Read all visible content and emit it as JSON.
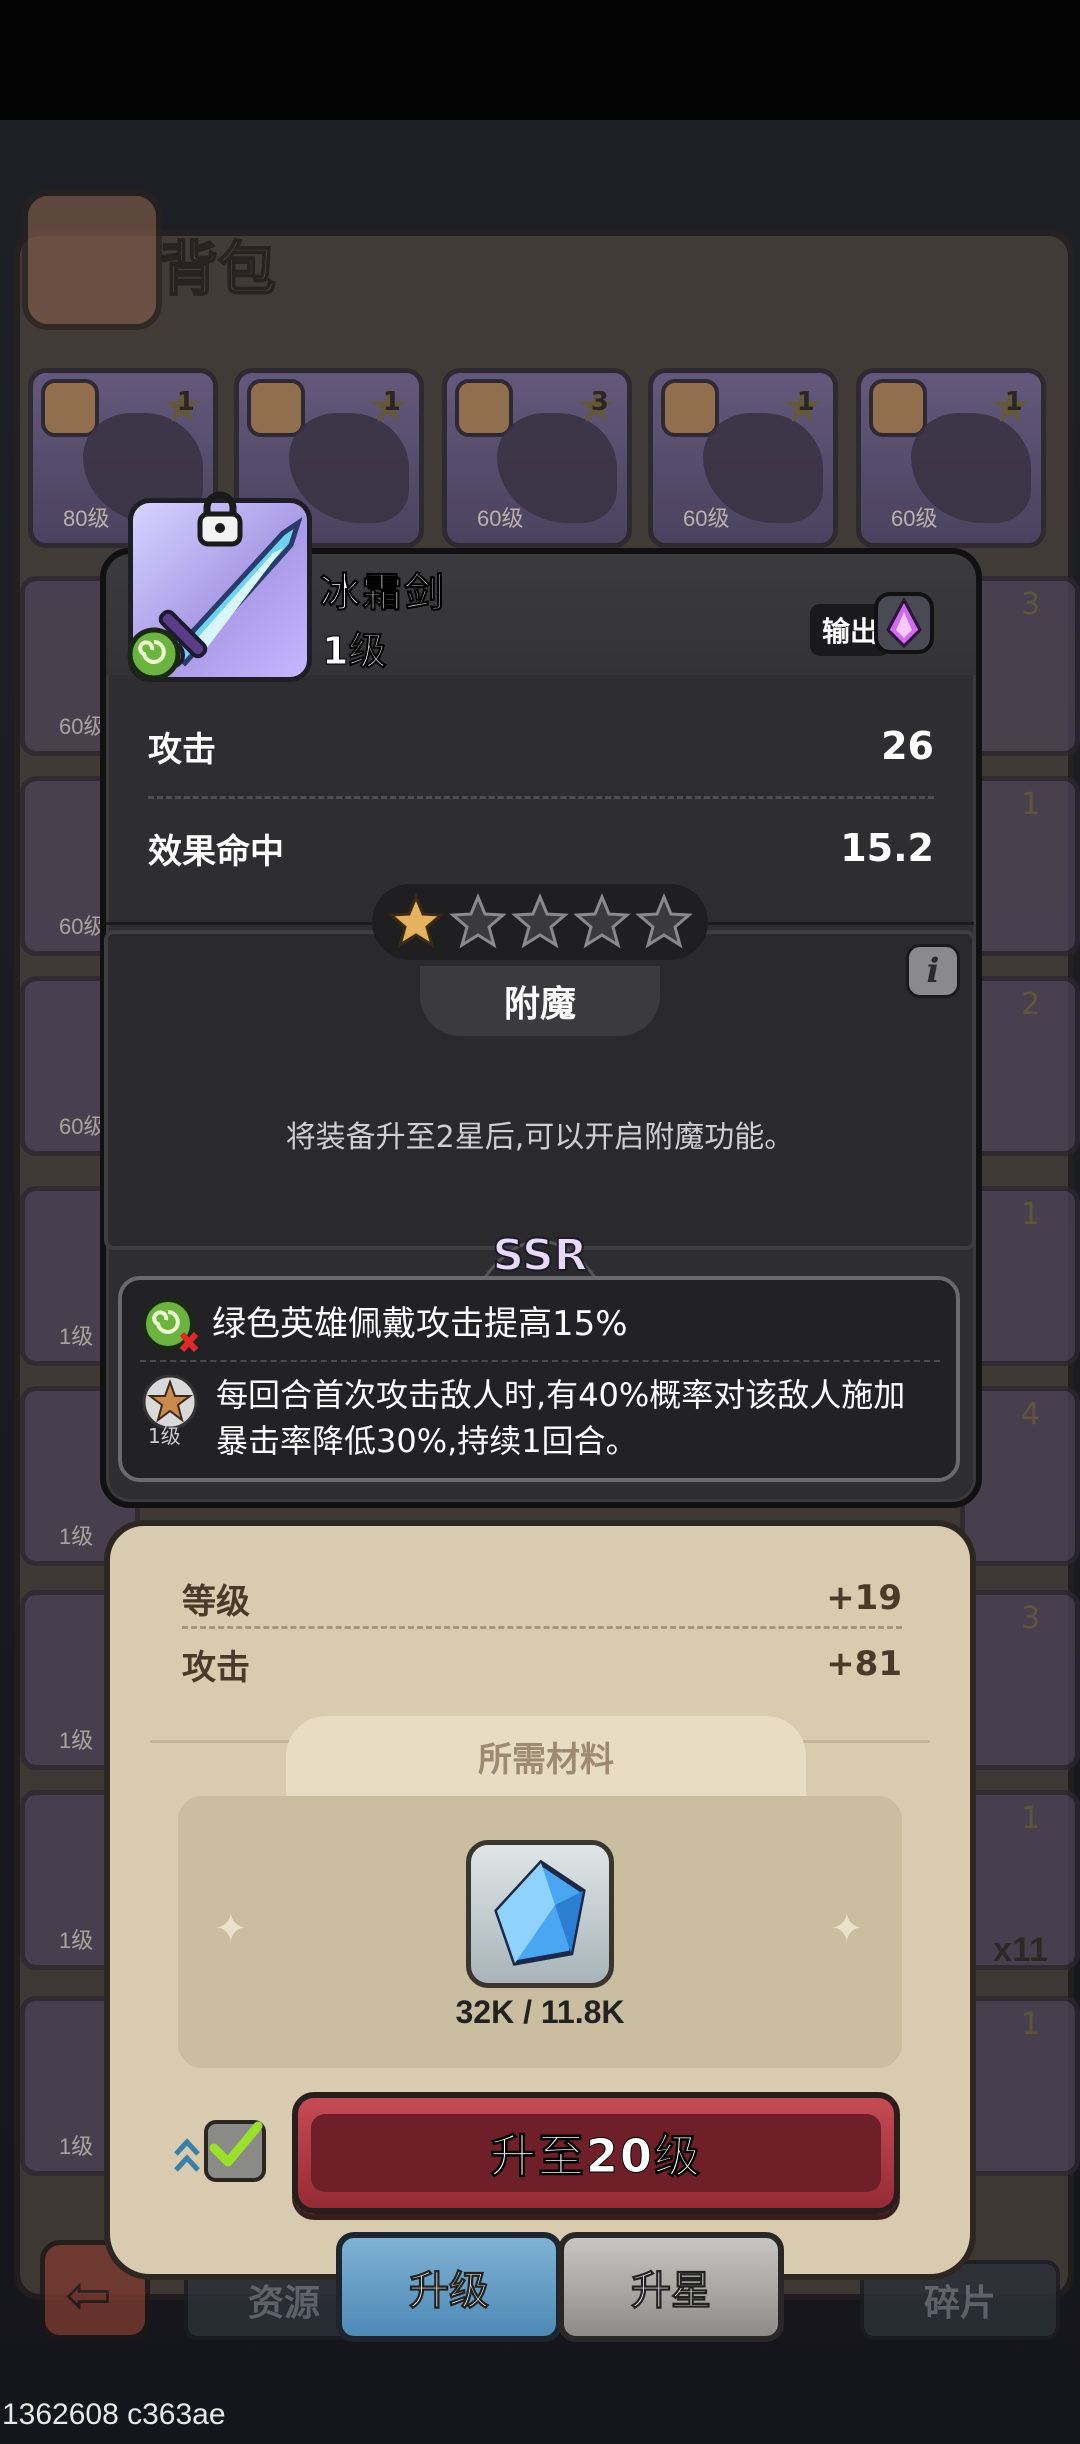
{
  "bag": {
    "title": "背包",
    "top_row": [
      {
        "level": "80级",
        "stars": "1",
        "color": "#6b5c90"
      },
      {
        "level": "",
        "stars": "1",
        "color": "#5c5278"
      },
      {
        "level": "60级",
        "stars": "3",
        "color": "#5f5486"
      },
      {
        "level": "60级",
        "stars": "1",
        "color": "#5c5278"
      },
      {
        "level": "60级",
        "stars": "1",
        "color": "#5f5486"
      }
    ],
    "left_column_levels": [
      "60级",
      "60级",
      "60级",
      "1级",
      "1级",
      "1级",
      "1级",
      "1级"
    ],
    "right_column_stars": [
      "3",
      "1",
      "2",
      "1",
      "4",
      "3",
      "1",
      "1"
    ],
    "right_partial_text": "x11",
    "tabs": [
      "资源",
      "升级",
      "升星",
      "碎片"
    ]
  },
  "item": {
    "name": "冰霜剑",
    "level": "1级",
    "role_label": "输出",
    "stats": [
      {
        "label": "攻击",
        "value": "26"
      },
      {
        "label": "效果命中",
        "value": "15.2"
      }
    ],
    "stars_filled": 1,
    "stars_total": 5,
    "enchant": {
      "title": "附魔",
      "text": "将装备升至2星后,可以开启附魔功能。"
    },
    "rarity": "SSR",
    "skill1": "绿色英雄佩戴攻击提高15%",
    "skill2_level": "1级",
    "skill2": "每回合首次攻击敌人时,有40%概率对该敌人施加暴击率降低30%,持续1回合。"
  },
  "upgrade": {
    "rows": [
      {
        "label": "等级",
        "value": "+19"
      },
      {
        "label": "攻击",
        "value": "+81"
      }
    ],
    "materials_title": "所需材料",
    "material_count": "32K / 11.8K",
    "auto_checked": true,
    "button_label": "升至20级"
  },
  "footer_id": "1362608 c363ae",
  "colors": {
    "popup_bg": "#2e2e30",
    "parchment": "#d9cbb0",
    "upgrade_button": "#b53a44",
    "active_tab": "#5f9cc6",
    "star_gold": "#e6b25e"
  }
}
